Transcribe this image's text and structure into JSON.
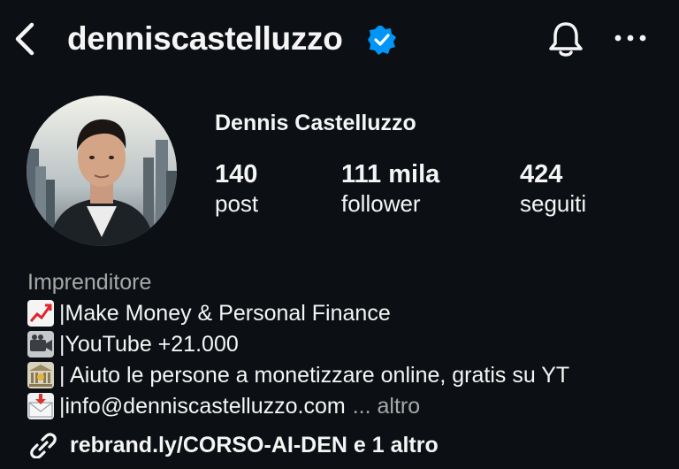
{
  "header": {
    "username": "denniscastelluzzo"
  },
  "profile": {
    "full_name": "Dennis Castelluzzo",
    "stats": [
      {
        "value": "140",
        "label": "post"
      },
      {
        "value": "111 mila",
        "label": "follower"
      },
      {
        "value": "424",
        "label": "seguiti"
      }
    ],
    "category": "Imprenditore",
    "bio": [
      {
        "text": "|Make Money & Personal Finance",
        "icon": "chart-increasing-icon"
      },
      {
        "text": "|YouTube +21.000",
        "icon": "video-camera-icon"
      },
      {
        "text": "| Aiuto le persone a monetizzare online, gratis su YT",
        "icon": "bank-icon"
      },
      {
        "text": "|info@denniscastelluzzo.com",
        "icon": "envelope-icon"
      }
    ],
    "more_label": "... altro",
    "link_text": "rebrand.ly/CORSO-AI-DEN e 1 altro"
  },
  "colors": {
    "background": "#0c1014",
    "text": "#f5f5f5",
    "secondary": "#a8a8a8",
    "verified": "#0095f6"
  }
}
